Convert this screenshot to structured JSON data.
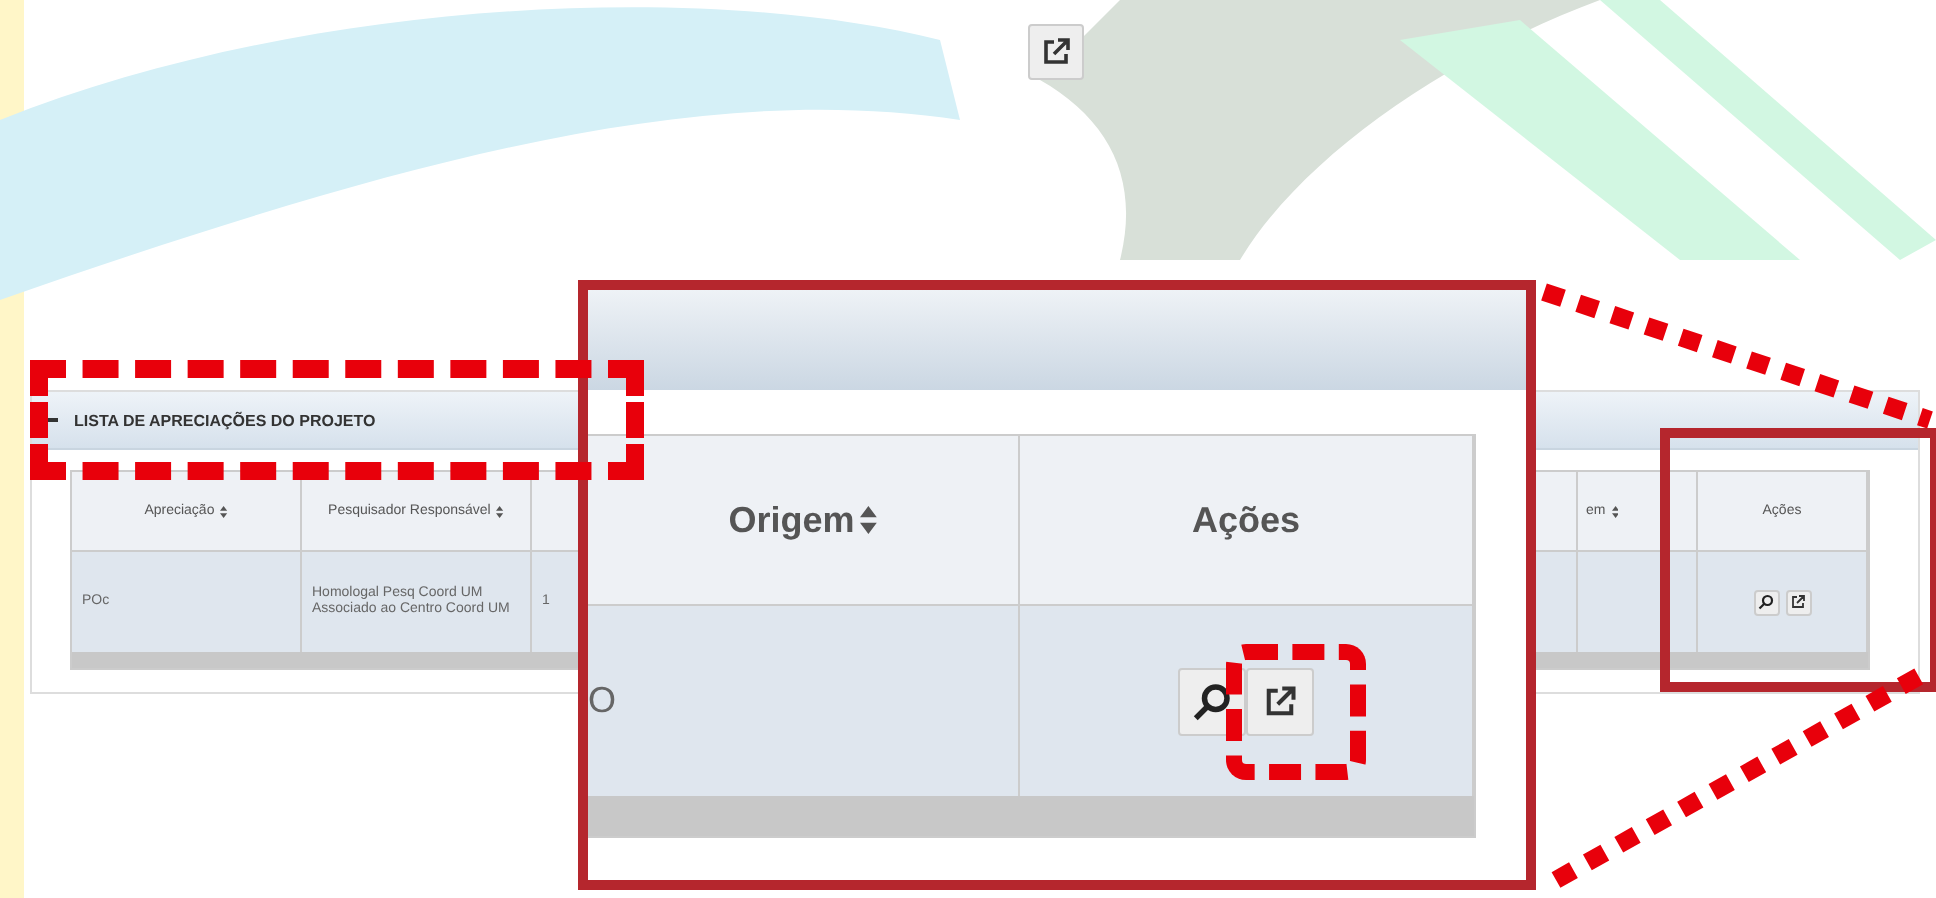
{
  "panel": {
    "title": "LISTA DE APRECIAÇÕES DO PROJETO",
    "expanded": true,
    "columns": [
      {
        "label": "Apreciação",
        "sortable": true
      },
      {
        "label": "Pesquisador Responsável",
        "sortable": true
      },
      {
        "label": "em",
        "sortable": true
      },
      {
        "label": "Ações",
        "sortable": false
      }
    ],
    "rows": [
      {
        "cells": [
          "POc",
          "Homologal Pesq Coord UM Associado ao Centro Coord UM",
          "1"
        ]
      }
    ]
  },
  "callout": {
    "columns": [
      {
        "label": "Origem",
        "sortable": true
      },
      {
        "label": "Ações",
        "sortable": false
      }
    ],
    "rows": [
      {
        "cells": [
          "O"
        ]
      }
    ]
  }
}
